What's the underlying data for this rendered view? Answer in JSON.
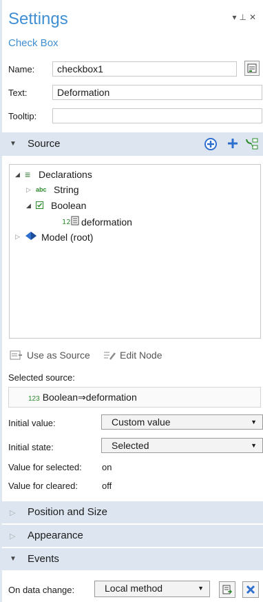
{
  "header": {
    "title": "Settings",
    "subtitle": "Check Box"
  },
  "form": {
    "name_label": "Name:",
    "name_value": "checkbox1",
    "text_label": "Text:",
    "text_value": "Deformation",
    "tooltip_label": "Tooltip:",
    "tooltip_value": ""
  },
  "source": {
    "header": "Source",
    "tree": {
      "declarations": "Declarations",
      "string_type": "abc",
      "string": "String",
      "boolean": "Boolean",
      "deformation": "deformation",
      "model": "Model (root)"
    },
    "use_as_source": "Use as Source",
    "edit_node": "Edit Node",
    "selected_source_label": "Selected source:",
    "selected_source_prefix": "123",
    "selected_source_value": "Boolean⇒deformation"
  },
  "options": {
    "initial_value_label": "Initial value:",
    "initial_value": "Custom value",
    "initial_state_label": "Initial state:",
    "initial_state": "Selected",
    "value_selected_label": "Value for selected:",
    "value_selected": "on",
    "value_cleared_label": "Value for cleared:",
    "value_cleared": "off"
  },
  "sections": {
    "position": "Position and Size",
    "appearance": "Appearance",
    "events": "Events"
  },
  "events": {
    "on_data_change_label": "On data change:",
    "on_data_change_value": "Local method"
  }
}
